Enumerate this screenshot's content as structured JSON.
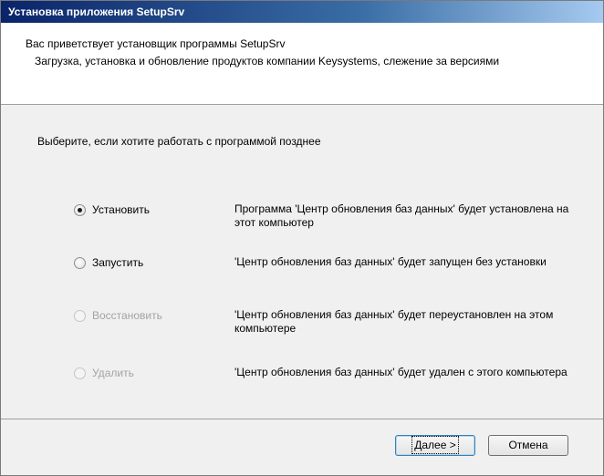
{
  "window": {
    "title": "Установка приложения SetupSrv"
  },
  "header": {
    "welcome": "Вас приветствует установщик программы SetupSrv",
    "description": "Загрузка, установка и обновление продуктов компании Keysystems, слежение за версиями"
  },
  "main": {
    "prompt": "Выберите, если хотите работать с программой позднее",
    "options": [
      {
        "label": "Установить",
        "description": "Программа 'Центр обновления баз данных' будет установлена на этот компьютер",
        "selected": true,
        "enabled": true
      },
      {
        "label": "Запустить",
        "description": "'Центр обновления баз данных' будет запущен без установки",
        "selected": false,
        "enabled": true
      },
      {
        "label": "Восстановить",
        "description": "'Центр обновления баз данных' будет переустановлен на этом компьютере",
        "selected": false,
        "enabled": false
      },
      {
        "label": "Удалить",
        "description": "'Центр обновления баз данных' будет удален с этого компьютера",
        "selected": false,
        "enabled": false
      }
    ]
  },
  "footer": {
    "next_label": "Далее >",
    "cancel_label": "Отмена"
  }
}
